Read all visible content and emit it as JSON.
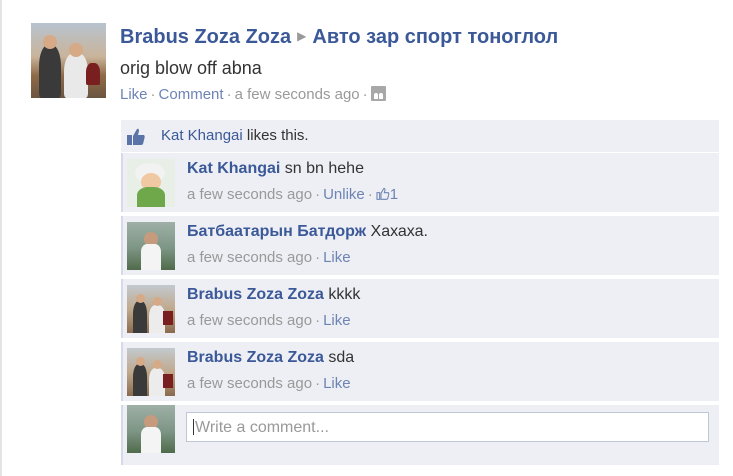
{
  "post": {
    "author": "Brabus Zoza Zoza",
    "target": "Авто зар спорт тоноглол",
    "text": "orig blow off abna",
    "actions": {
      "like": "Like",
      "comment": "Comment",
      "time": "a few seconds ago"
    },
    "privacy_icon": "friends-icon"
  },
  "likes": {
    "name": "Kat Khangai",
    "suffix": "likes this."
  },
  "comments": [
    {
      "author": "Kat Khangai",
      "text": "sn bn hehe",
      "time": "a few seconds ago",
      "action": "Unlike",
      "like_count": "1"
    },
    {
      "author": "Батбаатарын Батдорж",
      "text": "Хахаха.",
      "time": "a few seconds ago",
      "action": "Like"
    },
    {
      "author": "Brabus Zoza Zoza",
      "text": "kkkk",
      "time": "a few seconds ago",
      "action": "Like"
    },
    {
      "author": "Brabus Zoza Zoza",
      "text": "sda",
      "time": "a few seconds ago",
      "action": "Like"
    }
  ],
  "composer": {
    "placeholder": "Write a comment..."
  },
  "colors": {
    "link": "#3b5998",
    "meta": "#999999",
    "ufi_bg": "#edeff4"
  }
}
